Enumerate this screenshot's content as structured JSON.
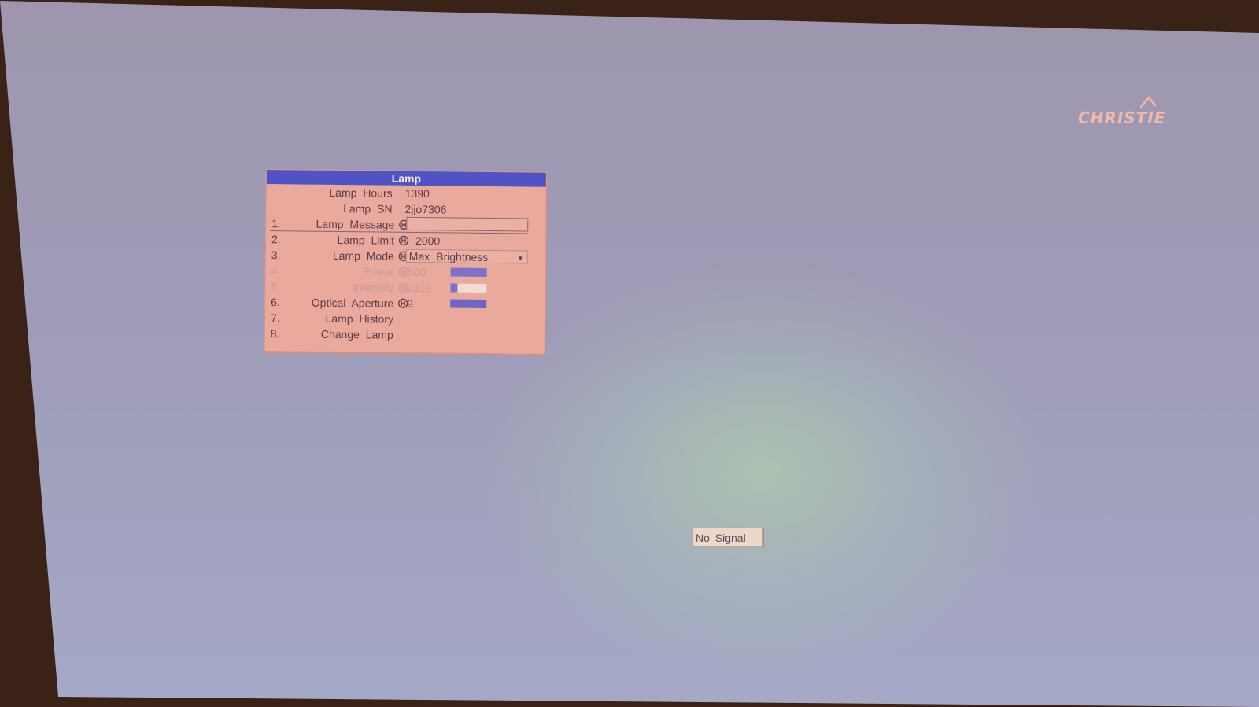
{
  "brand": {
    "logo_text": "CHRISTIE"
  },
  "menu": {
    "title": "Lamp",
    "info_rows": [
      {
        "label": "Lamp Hours",
        "value": "1390"
      },
      {
        "label": "Lamp SN",
        "value": "2jjo7306"
      }
    ],
    "items": [
      {
        "num": "1.",
        "label": "Lamp Message",
        "value": "",
        "control": "text-input",
        "selected": true,
        "enabled": true
      },
      {
        "num": "2.",
        "label": "Lamp Limit",
        "value": "2000",
        "control": "text",
        "enabled": true
      },
      {
        "num": "3.",
        "label": "Lamp Mode",
        "value": "Max Brightness",
        "control": "dropdown",
        "enabled": true
      },
      {
        "num": "4.",
        "label": "Power",
        "value": "500",
        "control": "slider",
        "level_fraction": 1.0,
        "enabled": false
      },
      {
        "num": "5.",
        "label": "Intensity",
        "value": "2319",
        "control": "slider",
        "level_fraction": 0.2,
        "enabled": false
      },
      {
        "num": "6.",
        "label": "Optical Aperture",
        "value": "9",
        "control": "slider",
        "level_fraction": 1.0,
        "enabled": true
      },
      {
        "num": "7.",
        "label": "Lamp History",
        "control": "submenu",
        "enabled": true
      },
      {
        "num": "8.",
        "label": "Change Lamp",
        "control": "submenu",
        "enabled": true
      }
    ]
  },
  "status": {
    "message": "No Signal"
  },
  "icons": {
    "lock": "lock-icon",
    "dropdown_arrow": "chevron-down-icon",
    "logo_mark": "christie-logo-icon"
  },
  "colors": {
    "menu_background": "#e9a99c",
    "title_bar": "#5053c3",
    "slider_fill": "#6e66c6",
    "screen": "#9f9cb8"
  }
}
